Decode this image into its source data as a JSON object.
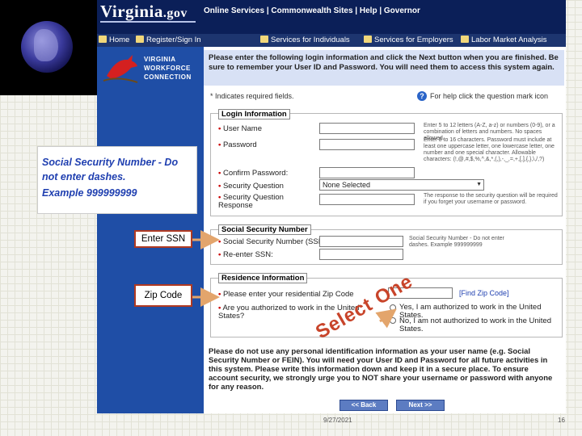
{
  "site": {
    "brand": "Virginia",
    "brand_suffix": ".gov",
    "top_links": "Online Services | Commonwealth Sites | Help | Governor",
    "nav": [
      "Home",
      "Register/Sign In",
      "Services for Individuals",
      "Services for Employers",
      "Labor Market Analysis"
    ]
  },
  "sidebar": {
    "logo_lines": [
      "VIRGINIA",
      "WORKFORCE",
      "CONNECTION"
    ]
  },
  "intro": "Please enter the following login information and click the Next button when you are finished. Be sure to remember your User ID and Password. You will need them to access this system again.",
  "required_note": "* Indicates required fields.",
  "help_note": "For help click the question mark icon",
  "login_section": {
    "title": "Login Information",
    "fields": [
      {
        "label": "User Name",
        "hint": "Enter 5 to 12 letters (A-Z, a-z) or numbers (0-9), or a combination of letters and numbers. No spaces allowed."
      },
      {
        "label": "Password",
        "hint": "Enter 8 to 16 characters. Password must include at least one uppercase letter, one lowercase letter, one number and one special character. Allowable characters: (!,@,#,$,%,^,&,*,(,),-,_,=,+,[,],{,},\\,/,?)"
      },
      {
        "label": "Confirm Password:",
        "hint": ""
      },
      {
        "label": "Security Question",
        "value": "None Selected",
        "hint": ""
      },
      {
        "label": "Security Question Response",
        "hint": "The response to the security question will be required if you forget your username or password."
      }
    ]
  },
  "ssn_section": {
    "title": "Social Security Number",
    "fields": [
      {
        "label": "Social Security Number (SSN)",
        "hint": "Social Security Number - Do not enter dashes. Example 999999999"
      },
      {
        "label": "Re-enter SSN:"
      }
    ]
  },
  "residence_section": {
    "title": "Residence Information",
    "zip_label": "Please enter your residential Zip Code",
    "zip_link": "[Find Zip Code]",
    "work_question": "Are you authorized to work in the United States?",
    "options": [
      "Yes, I am authorized to work in the United States.",
      "No, I am not authorized to work in the United States."
    ]
  },
  "warning": "Please do not use any personal identification information as your user name (e.g. Social Security Number or FEIN). You will need your User ID and Password for all future activities in this system. Please write this information down and keep it in a secure place. To ensure account security, we strongly urge you to NOT share your username or password with anyone for any reason.",
  "buttons": {
    "back": "<< Back",
    "next": "Next >>"
  },
  "overlays": {
    "ssn_note_line1": "Social Security Number - Do not enter dashes.",
    "ssn_note_line2": "Example 999999999",
    "enter_ssn": "Enter SSN",
    "zip_code": "Zip Code",
    "select_one": "Select One"
  },
  "footer": {
    "date": "9/27/2021",
    "page": "16"
  },
  "colors": {
    "accent": "#1f4ea6",
    "callout_border": "#b03a22",
    "arrow": "#e3a56c"
  }
}
